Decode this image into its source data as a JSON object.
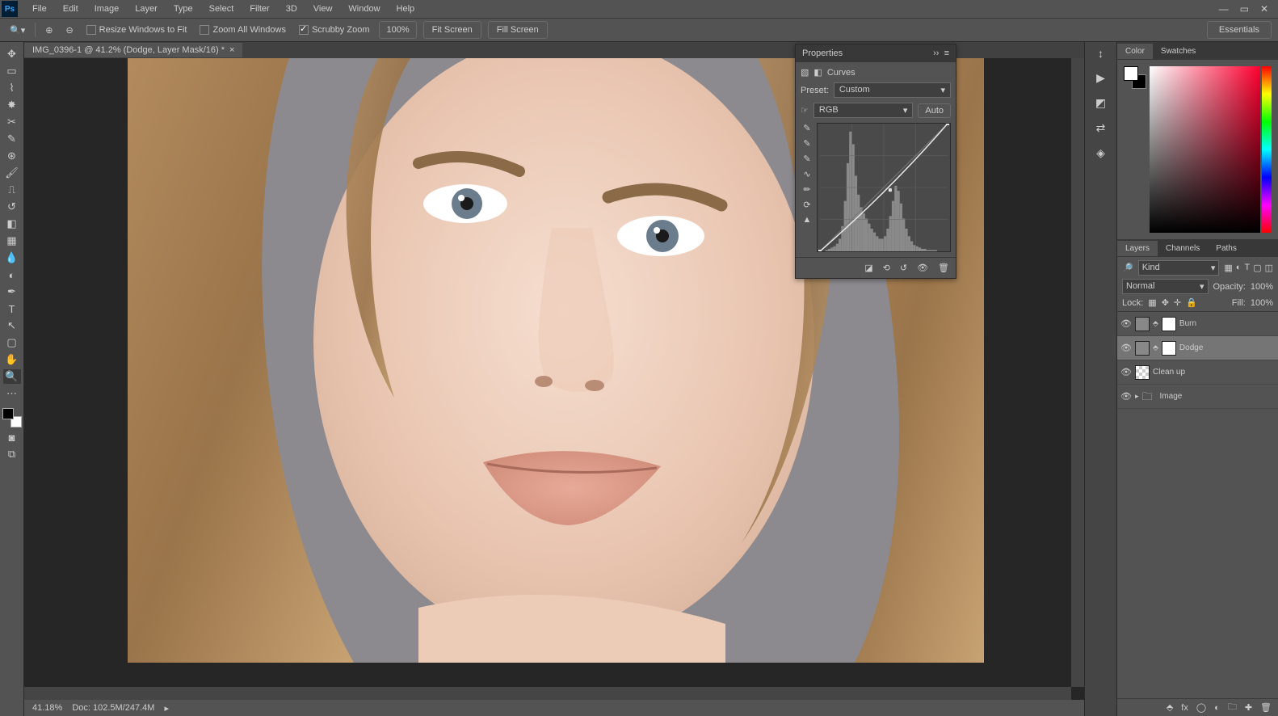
{
  "menubar": [
    "File",
    "Edit",
    "Image",
    "Layer",
    "Type",
    "Select",
    "Filter",
    "3D",
    "View",
    "Window",
    "Help"
  ],
  "optionsbar": {
    "resize_windows": "Resize Windows to Fit",
    "zoom_all": "Zoom All Windows",
    "scrubby": "Scrubby Zoom",
    "zoom_pct": "100%",
    "fit": "Fit Screen",
    "fill": "Fill Screen",
    "workspace": "Essentials"
  },
  "document": {
    "tab_label": "IMG_0396-1 @ 41.2% (Dodge, Layer Mask/16) *"
  },
  "status": {
    "zoom": "41.18%",
    "doc": "Doc: 102.5M/247.4M"
  },
  "right_panel_tabs": {
    "color": "Color",
    "swatches": "Swatches",
    "layers": "Layers",
    "channels": "Channels",
    "paths": "Paths"
  },
  "layers_panel": {
    "kind_label": "Kind",
    "blend_mode": "Normal",
    "opacity_label": "Opacity:",
    "opacity_val": "100%",
    "lock_label": "Lock:",
    "fill_label": "Fill:",
    "fill_val": "100%",
    "layers": [
      {
        "name": "Burn",
        "type": "curves",
        "selected": false
      },
      {
        "name": "Dodge",
        "type": "curves",
        "selected": true
      },
      {
        "name": "Clean up",
        "type": "pixel",
        "selected": false
      },
      {
        "name": "Image",
        "type": "group",
        "selected": false
      }
    ]
  },
  "properties": {
    "title": "Properties",
    "type_label": "Curves",
    "preset_label": "Preset:",
    "preset_val": "Custom",
    "channel_val": "RGB",
    "auto": "Auto",
    "histogram": [
      0,
      0,
      1,
      2,
      3,
      4,
      6,
      10,
      20,
      40,
      70,
      95,
      85,
      60,
      45,
      35,
      30,
      26,
      22,
      18,
      15,
      12,
      10,
      10,
      12,
      18,
      28,
      40,
      52,
      48,
      38,
      26,
      18,
      12,
      8,
      5,
      4,
      3,
      2,
      2,
      1,
      1,
      1,
      1,
      0,
      0,
      0,
      0
    ],
    "curve_points": [
      [
        0,
        0
      ],
      [
        0.55,
        0.48
      ],
      [
        1,
        1
      ]
    ]
  }
}
